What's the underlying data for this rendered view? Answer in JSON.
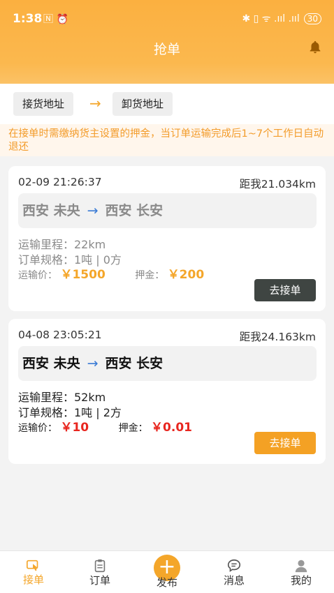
{
  "status_bar": {
    "time": "1:38",
    "left_icons": "🄽 ⏰",
    "right_icons": "✱ ▯ ᯤ .ııl .ııl",
    "battery": "30"
  },
  "header": {
    "title": "抢单"
  },
  "filter": {
    "from_label": "接货地址",
    "arrow": "→",
    "to_label": "卸货地址"
  },
  "notice": {
    "text": "在接单时需缴纳货主设置的押金，当订单运输完成后1~7个工作日自动退还"
  },
  "orders": [
    {
      "datetime": "02-09 21:26:37",
      "distance": "距我21.034km",
      "origin": "西安 未央",
      "route_arrow": "→",
      "destination": "西安 长安",
      "mileage": "运输里程：22km",
      "spec": "订单规格：1吨 | 0方",
      "price_label": "运输价：",
      "price": "￥1500",
      "deposit_label": "押金：",
      "deposit": "￥200",
      "button": "去接单"
    },
    {
      "datetime": "04-08 23:05:21",
      "distance": "距我24.163km",
      "origin": "西安 未央",
      "route_arrow": "→",
      "destination": "西安 长安",
      "mileage": "运输里程：52km",
      "spec": "订单规格：1吨 | 2方",
      "price_label": "运输价：",
      "price": "￥10",
      "deposit_label": "押金：",
      "deposit": "￥0.01",
      "button": "去接单"
    }
  ],
  "bottom_nav": {
    "accept": "接单",
    "orders": "订单",
    "publish": "发布",
    "publish_symbol": "+",
    "messages": "消息",
    "mine": "我的"
  },
  "colors": {
    "brand": "#fbb040",
    "accent_orange": "#f4a62a",
    "price_red": "#e8261f",
    "route_arrow_blue": "#3a7bd5",
    "dark_button": "#3f4542"
  }
}
